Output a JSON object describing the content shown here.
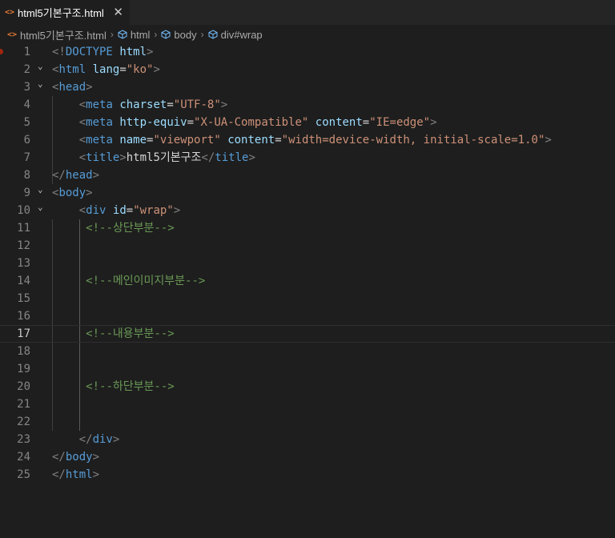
{
  "tab": {
    "file_icon": "<>",
    "label": "html5기본구조.html",
    "close": "✕"
  },
  "breadcrumb": {
    "file": "html5기본구조.html",
    "items": [
      "html",
      "body",
      "div#wrap"
    ]
  },
  "editor": {
    "current_line": 17,
    "line_numbers": [
      "1",
      "2",
      "3",
      "4",
      "5",
      "6",
      "7",
      "8",
      "9",
      "10",
      "11",
      "12",
      "13",
      "14",
      "15",
      "16",
      "17",
      "18",
      "19",
      "20",
      "21",
      "22",
      "23",
      "24",
      "25"
    ],
    "lines": [
      [
        [
          "punc",
          "<!"
        ],
        [
          "tag",
          "DOCTYPE"
        ],
        [
          "txt",
          " "
        ],
        [
          "attr",
          "html"
        ],
        [
          "punc",
          ">"
        ]
      ],
      [
        [
          "punc",
          "<"
        ],
        [
          "tag",
          "html"
        ],
        [
          "txt",
          " "
        ],
        [
          "attr",
          "lang"
        ],
        [
          "txt",
          "="
        ],
        [
          "str",
          "\"ko\""
        ],
        [
          "punc",
          ">"
        ]
      ],
      [
        [
          "punc",
          "<"
        ],
        [
          "tag",
          "head"
        ],
        [
          "punc",
          ">"
        ]
      ],
      [
        [
          "txt",
          "    "
        ],
        [
          "punc",
          "<"
        ],
        [
          "tag",
          "meta"
        ],
        [
          "txt",
          " "
        ],
        [
          "attr",
          "charset"
        ],
        [
          "txt",
          "="
        ],
        [
          "str",
          "\"UTF-8\""
        ],
        [
          "punc",
          ">"
        ]
      ],
      [
        [
          "txt",
          "    "
        ],
        [
          "punc",
          "<"
        ],
        [
          "tag",
          "meta"
        ],
        [
          "txt",
          " "
        ],
        [
          "attr",
          "http-equiv"
        ],
        [
          "txt",
          "="
        ],
        [
          "str",
          "\"X-UA-Compatible\""
        ],
        [
          "txt",
          " "
        ],
        [
          "attr",
          "content"
        ],
        [
          "txt",
          "="
        ],
        [
          "str",
          "\"IE=edge\""
        ],
        [
          "punc",
          ">"
        ]
      ],
      [
        [
          "txt",
          "    "
        ],
        [
          "punc",
          "<"
        ],
        [
          "tag",
          "meta"
        ],
        [
          "txt",
          " "
        ],
        [
          "attr",
          "name"
        ],
        [
          "txt",
          "="
        ],
        [
          "str",
          "\"viewport\""
        ],
        [
          "txt",
          " "
        ],
        [
          "attr",
          "content"
        ],
        [
          "txt",
          "="
        ],
        [
          "str",
          "\"width=device-width, initial-scale=1.0\""
        ],
        [
          "punc",
          ">"
        ]
      ],
      [
        [
          "txt",
          "    "
        ],
        [
          "punc",
          "<"
        ],
        [
          "tag",
          "title"
        ],
        [
          "punc",
          ">"
        ],
        [
          "txt",
          "html5기본구조"
        ],
        [
          "punc",
          "</"
        ],
        [
          "tag",
          "title"
        ],
        [
          "punc",
          ">"
        ]
      ],
      [
        [
          "punc",
          "</"
        ],
        [
          "tag",
          "head"
        ],
        [
          "punc",
          ">"
        ]
      ],
      [
        [
          "punc",
          "<"
        ],
        [
          "tag",
          "body"
        ],
        [
          "punc",
          ">"
        ]
      ],
      [
        [
          "txt",
          "    "
        ],
        [
          "punc",
          "<"
        ],
        [
          "tag",
          "div"
        ],
        [
          "txt",
          " "
        ],
        [
          "attr",
          "id"
        ],
        [
          "txt",
          "="
        ],
        [
          "str",
          "\"wrap\""
        ],
        [
          "punc",
          ">"
        ]
      ],
      [
        [
          "txt",
          "     "
        ],
        [
          "com",
          "<!--상단부분-->"
        ]
      ],
      [],
      [],
      [
        [
          "txt",
          "     "
        ],
        [
          "com",
          "<!--메인이미지부분-->"
        ]
      ],
      [],
      [],
      [
        [
          "txt",
          "     "
        ],
        [
          "com",
          "<!--내용부분-->"
        ]
      ],
      [],
      [],
      [
        [
          "txt",
          "     "
        ],
        [
          "com",
          "<!--하단부분-->"
        ]
      ],
      [],
      [],
      [
        [
          "txt",
          "    "
        ],
        [
          "punc",
          "</"
        ],
        [
          "tag",
          "div"
        ],
        [
          "punc",
          ">"
        ]
      ],
      [
        [
          "punc",
          "</"
        ],
        [
          "tag",
          "body"
        ],
        [
          "punc",
          ">"
        ]
      ],
      [
        [
          "punc",
          "</"
        ],
        [
          "tag",
          "html"
        ],
        [
          "punc",
          ">"
        ]
      ]
    ],
    "fold_lines": [
      2,
      3,
      9,
      10
    ]
  }
}
